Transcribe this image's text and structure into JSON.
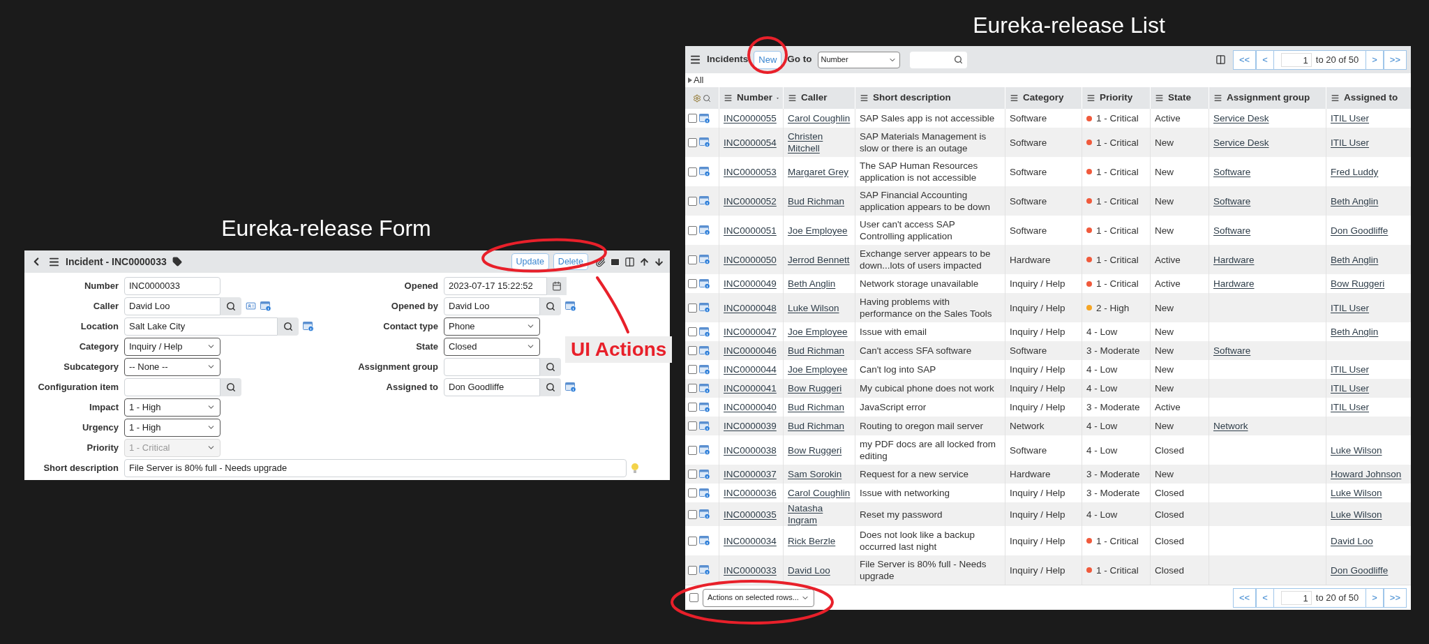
{
  "form_heading": "Eureka-release Form",
  "list_heading": "Eureka-release List",
  "annotation": {
    "label": "UI Actions"
  },
  "form": {
    "title": "Incident - INC0000033",
    "buttons": [
      "Update",
      "Delete"
    ],
    "left_fields": [
      {
        "label": "Number",
        "kind": "text",
        "value": "INC0000033",
        "disabled": false
      },
      {
        "label": "Caller",
        "kind": "lookup",
        "value": "David Loo",
        "disabled": false
      },
      {
        "label": "Location",
        "kind": "lookup-wide",
        "value": "Salt Lake City",
        "disabled": false
      },
      {
        "label": "Category",
        "kind": "select",
        "value": "Inquiry / Help",
        "disabled": false
      },
      {
        "label": "Subcategory",
        "kind": "select",
        "value": "-- None --",
        "disabled": false
      },
      {
        "label": "Configuration item",
        "kind": "lookup",
        "disabled": false
      },
      {
        "label": "Impact",
        "kind": "select",
        "value": "1 - High",
        "disabled": false
      },
      {
        "label": "Urgency",
        "kind": "select",
        "value": "1 - High",
        "disabled": false
      },
      {
        "label": "Priority",
        "kind": "select",
        "value": "1 - Critical",
        "disabled": true
      }
    ],
    "right_fields": [
      {
        "label": "Opened",
        "kind": "date",
        "value": "2023-07-17 15:22:52",
        "disabled": false
      },
      {
        "label": "Opened by",
        "kind": "lookup",
        "value": "David Loo",
        "disabled": false
      },
      {
        "label": "Contact type",
        "kind": "select",
        "value": "Phone",
        "disabled": false
      },
      {
        "label": "State",
        "kind": "select",
        "value": "Closed",
        "disabled": false
      },
      {
        "label": "Assignment group",
        "kind": "lookup",
        "disabled": false
      },
      {
        "label": "Assigned to",
        "kind": "lookup",
        "value": "Don Goodliffe",
        "disabled": false
      }
    ],
    "short_description": {
      "label": "Short description",
      "value": "File Server is 80% full - Needs upgrade"
    }
  },
  "list": {
    "title": "Incidents",
    "new_button": "New",
    "goto_label": "Go to",
    "goto_select": "Number",
    "breadcrumb": "All",
    "pager_top": {
      "first": "<<",
      "prev": "<",
      "page": "1",
      "range": "to 20 of 50",
      "next": ">",
      "last": ">>"
    },
    "pager_bottom": {
      "first": "<<",
      "prev": "<",
      "page": "1",
      "range": "to 20 of 50",
      "next": ">",
      "last": ">>"
    },
    "select_all_checked": false,
    "columns": [
      "Number",
      "Caller",
      "Short description",
      "Category",
      "Priority",
      "State",
      "Assignment group",
      "Assigned to"
    ],
    "rows": [
      {
        "checked": false,
        "number": "INC0000055",
        "caller": "Carol Coughlin",
        "description": "SAP Sales app is not accessible",
        "category": "Software",
        "priority": "1 - Critical",
        "color": "#f05a3c",
        "state": "Active",
        "group": "Service Desk",
        "assigned": "ITIL User"
      },
      {
        "checked": false,
        "number": "INC0000054",
        "caller": "Christen Mitchell",
        "description": "SAP Materials Management is slow or there is an outage",
        "category": "Software",
        "priority": "1 - Critical",
        "color": "#f05a3c",
        "state": "New",
        "group": "Service Desk",
        "assigned": "ITIL User"
      },
      {
        "checked": false,
        "number": "INC0000053",
        "caller": "Margaret Grey",
        "description": "The SAP Human Resources application is not accessible",
        "category": "Software",
        "priority": "1 - Critical",
        "color": "#f05a3c",
        "state": "New",
        "group": "Software",
        "assigned": "Fred Luddy"
      },
      {
        "checked": false,
        "number": "INC0000052",
        "caller": "Bud Richman",
        "description": "SAP Financial Accounting application appears to be down",
        "category": "Software",
        "priority": "1 - Critical",
        "color": "#f05a3c",
        "state": "New",
        "group": "Software",
        "assigned": "Beth Anglin"
      },
      {
        "checked": false,
        "number": "INC0000051",
        "caller": "Joe Employee",
        "description": "User can't access SAP Controlling application",
        "category": "Software",
        "priority": "1 - Critical",
        "color": "#f05a3c",
        "state": "New",
        "group": "Software",
        "assigned": "Don Goodliffe"
      },
      {
        "checked": false,
        "number": "INC0000050",
        "caller": "Jerrod Bennett",
        "description": "Exchange server appears to be down...lots of users impacted",
        "category": "Hardware",
        "priority": "1 - Critical",
        "color": "#f05a3c",
        "state": "Active",
        "group": "Hardware",
        "assigned": "Beth Anglin"
      },
      {
        "checked": false,
        "number": "INC0000049",
        "caller": "Beth Anglin",
        "description": "Network storage unavailable",
        "category": "Inquiry / Help",
        "priority": "1 - Critical",
        "color": "#f05a3c",
        "state": "Active",
        "group": "Hardware",
        "assigned": "Bow Ruggeri"
      },
      {
        "checked": false,
        "number": "INC0000048",
        "caller": "Luke Wilson",
        "description": "Having problems with performance on the Sales Tools",
        "category": "Inquiry / Help",
        "priority": "2 - High",
        "color": "#f5a524",
        "state": "New",
        "assigned": "ITIL User"
      },
      {
        "checked": false,
        "number": "INC0000047",
        "caller": "Joe Employee",
        "description": "Issue with email",
        "category": "Inquiry / Help",
        "priority": "4 - Low",
        "state": "New",
        "assigned": "Beth Anglin"
      },
      {
        "checked": false,
        "number": "INC0000046",
        "caller": "Bud Richman",
        "description": "Can't access SFA software",
        "category": "Software",
        "priority": "3 - Moderate",
        "state": "New",
        "group": "Software"
      },
      {
        "checked": false,
        "number": "INC0000044",
        "caller": "Joe Employee",
        "description": "Can't log into SAP",
        "category": "Inquiry / Help",
        "priority": "4 - Low",
        "state": "New",
        "assigned": "ITIL User"
      },
      {
        "checked": false,
        "number": "INC0000041",
        "caller": "Bow Ruggeri",
        "description": "My cubical phone does not work",
        "category": "Inquiry / Help",
        "priority": "4 - Low",
        "state": "New",
        "assigned": "ITIL User"
      },
      {
        "checked": false,
        "number": "INC0000040",
        "caller": "Bud Richman",
        "description": "JavaScript error",
        "category": "Inquiry / Help",
        "priority": "3 - Moderate",
        "state": "Active",
        "assigned": "ITIL User"
      },
      {
        "checked": false,
        "number": "INC0000039",
        "caller": "Bud Richman",
        "description": "Routing to oregon mail server",
        "category": "Network",
        "priority": "4 - Low",
        "state": "New",
        "group": "Network"
      },
      {
        "checked": false,
        "number": "INC0000038",
        "caller": "Bow Ruggeri",
        "description": "my PDF docs are all locked from editing",
        "category": "Software",
        "priority": "4 - Low",
        "state": "Closed",
        "assigned": "Luke Wilson"
      },
      {
        "checked": false,
        "number": "INC0000037",
        "caller": "Sam Sorokin",
        "description": "Request for a new service",
        "category": "Hardware",
        "priority": "3 - Moderate",
        "state": "New",
        "assigned": "Howard Johnson"
      },
      {
        "checked": false,
        "number": "INC0000036",
        "caller": "Carol Coughlin",
        "description": "Issue with networking",
        "category": "Inquiry / Help",
        "priority": "3 - Moderate",
        "state": "Closed",
        "assigned": "Luke Wilson"
      },
      {
        "checked": false,
        "number": "INC0000035",
        "caller": "Natasha Ingram",
        "description": "Reset my password",
        "category": "Inquiry / Help",
        "priority": "4 - Low",
        "state": "Closed",
        "assigned": "Luke Wilson"
      },
      {
        "checked": false,
        "number": "INC0000034",
        "caller": "Rick Berzle",
        "description": "Does not look like a backup occurred last night",
        "category": "Inquiry / Help",
        "priority": "1 - Critical",
        "color": "#f05a3c",
        "state": "Closed",
        "assigned": "David Loo"
      },
      {
        "checked": false,
        "number": "INC0000033",
        "caller": "David Loo",
        "description": "File Server is 80% full - Needs upgrade",
        "category": "Inquiry / Help",
        "priority": "1 - Critical",
        "color": "#f05a3c",
        "state": "Closed",
        "assigned": "Don Goodliffe"
      }
    ],
    "footer_select": "Actions on selected rows..."
  }
}
